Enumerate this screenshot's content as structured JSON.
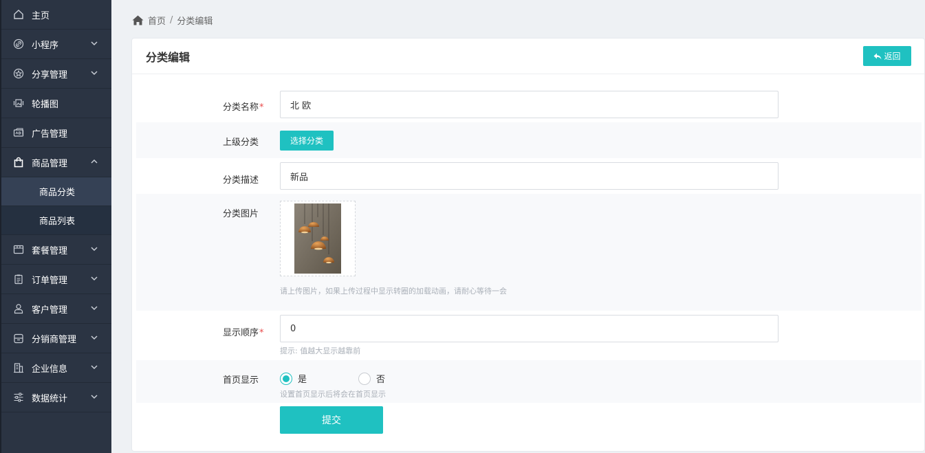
{
  "sidebar": {
    "items": [
      {
        "label": "主页",
        "icon": "home-icon"
      },
      {
        "label": "小程序",
        "icon": "link-icon"
      },
      {
        "label": "分享管理",
        "icon": "star-icon"
      },
      {
        "label": "轮播图",
        "icon": "carousel-icon"
      },
      {
        "label": "广告管理",
        "icon": "ad-icon"
      },
      {
        "label": "商品管理",
        "icon": "bag-icon"
      },
      {
        "label": "套餐管理",
        "icon": "box-icon"
      },
      {
        "label": "订单管理",
        "icon": "clipboard-icon"
      },
      {
        "label": "客户管理",
        "icon": "user-icon"
      },
      {
        "label": "分销商管理",
        "icon": "store-icon"
      },
      {
        "label": "企业信息",
        "icon": "building-icon"
      },
      {
        "label": "数据统计",
        "icon": "sliders-icon"
      }
    ],
    "subitems": [
      {
        "label": "商品分类"
      },
      {
        "label": "商品列表"
      }
    ]
  },
  "breadcrumb": {
    "home": "首页",
    "separator": "/",
    "current": "分类编辑"
  },
  "panel": {
    "title": "分类编辑",
    "back_label": "返回"
  },
  "form": {
    "name_label": "分类名称",
    "name_value": "北 欧",
    "required_mark": "*",
    "parent_label": "上级分类",
    "parent_button": "选择分类",
    "desc_label": "分类描述",
    "desc_value": "新品",
    "image_label": "分类图片",
    "image_help": "请上传图片，如果上传过程中显示转圈的加载动画，请耐心等待一会",
    "order_label": "显示顺序",
    "order_value": "0",
    "order_help": "提示: 值越大显示越靠前",
    "home_label": "首页显示",
    "home_yes": "是",
    "home_no": "否",
    "home_help": "设置首页显示后将会在首页显示",
    "submit_label": "提交"
  },
  "colors": {
    "accent": "#1fc1c1",
    "sidebar": "#2b3443",
    "required": "#e94b4b"
  }
}
